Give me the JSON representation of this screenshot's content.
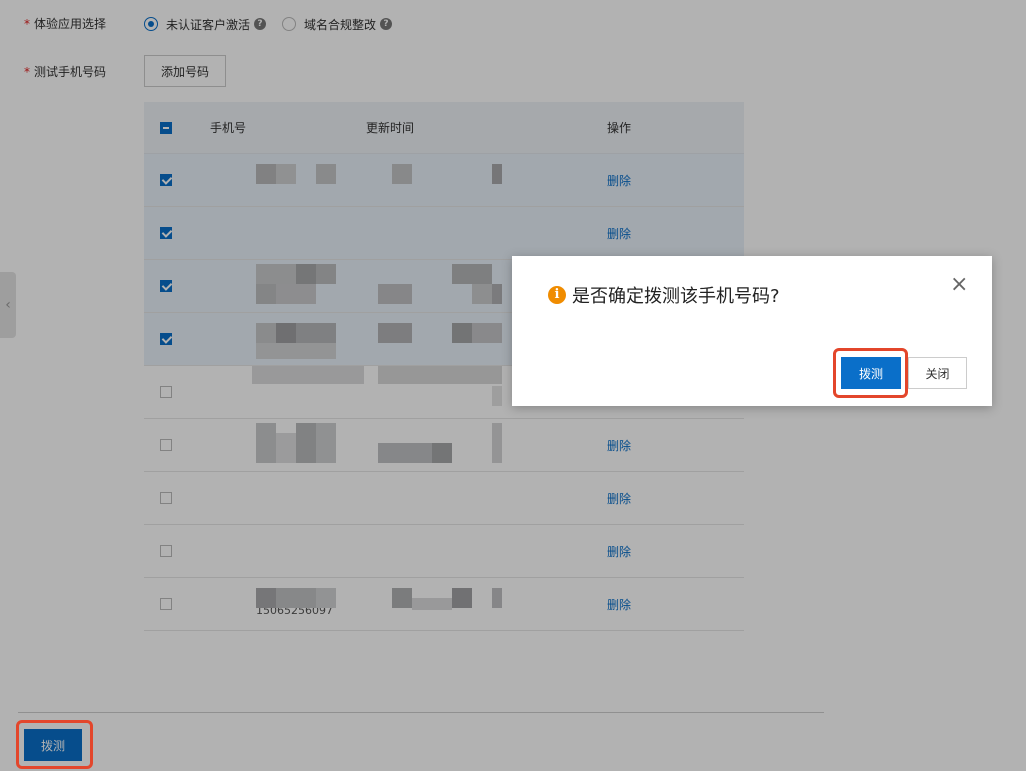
{
  "form": {
    "app_select_label": "体验应用选择",
    "required_mark": "*",
    "radio_options": [
      {
        "label": "未认证客户激活",
        "selected": true
      },
      {
        "label": "域名合规整改",
        "selected": false
      }
    ],
    "help_glyph": "?",
    "phone_label": "测试手机号码",
    "add_phone_button": "添加号码"
  },
  "table": {
    "columns": [
      "手机号",
      "更新时间",
      "操作"
    ],
    "rows": [
      {
        "checked": true,
        "phone": "",
        "action": "删除"
      },
      {
        "checked": true,
        "phone": "",
        "action": "删除"
      },
      {
        "checked": true,
        "phone": "",
        "action": ""
      },
      {
        "checked": true,
        "phone": "",
        "action": ""
      },
      {
        "checked": false,
        "phone": "",
        "action": ""
      },
      {
        "checked": false,
        "phone": "",
        "action": "删除"
      },
      {
        "checked": false,
        "phone": "",
        "action": "删除"
      },
      {
        "checked": false,
        "phone": "",
        "action": "删除"
      },
      {
        "checked": false,
        "phone": "15065256097",
        "action": "删除"
      }
    ]
  },
  "side_toggle_glyph": "‹",
  "footer": {
    "dial_button": "拨测"
  },
  "dialog": {
    "info_glyph": "i",
    "message": "是否确定拨测该手机号码?",
    "close_glyph": "×",
    "confirm_button": "拨测",
    "cancel_button": "关闭"
  },
  "colors": {
    "primary": "#0a6fc9",
    "highlight": "#e3462b",
    "warning": "#f08c00"
  }
}
